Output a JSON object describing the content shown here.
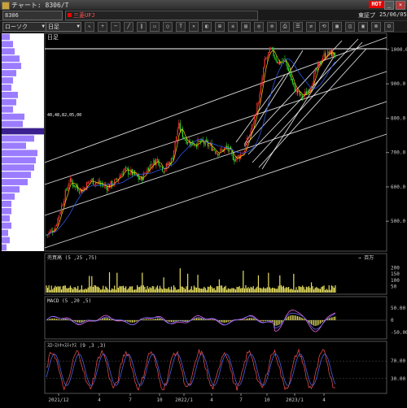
{
  "window": {
    "title": "チャート: 8306/T",
    "hot": "HOT"
  },
  "toolbar": {
    "code": "8306",
    "name": "三菱UFJ",
    "exchange": "東証プ",
    "date": "25/06/05",
    "chart_type": "ローソク",
    "period": "日足"
  },
  "panels": {
    "price_label": "日足",
    "volume_label": "売買高 (5 ,25 ,75)",
    "volume_unit": "→ 百万",
    "macd_label": "MACD (5 ,20 ,5)",
    "stoch_label": "ｽﾛｰｽﾄｷｬｽﾃｨｸｽ (9 ,3 ,3)",
    "profile_label": "40,48,82,05,00"
  },
  "chart_data": [
    {
      "type": "candlestick",
      "panel": "price",
      "yticks": [
        "1000.0",
        "900.0",
        "800.0",
        "700.0",
        "600.0",
        "500.0"
      ],
      "ylim": [
        420,
        1040
      ],
      "xticks": [
        "2021/12",
        "4",
        "7",
        "10",
        "2022/1",
        "4",
        "7",
        "10",
        "2023/1",
        "4"
      ],
      "close_path": [
        [
          0,
          460
        ],
        [
          8,
          480
        ],
        [
          16,
          560
        ],
        [
          22,
          620
        ],
        [
          28,
          600
        ],
        [
          34,
          590
        ],
        [
          42,
          620
        ],
        [
          50,
          610
        ],
        [
          58,
          600
        ],
        [
          66,
          615
        ],
        [
          74,
          650
        ],
        [
          82,
          640
        ],
        [
          90,
          620
        ],
        [
          98,
          660
        ],
        [
          106,
          680
        ],
        [
          112,
          650
        ],
        [
          120,
          680
        ],
        [
          126,
          780
        ],
        [
          132,
          740
        ],
        [
          140,
          725
        ],
        [
          148,
          730
        ],
        [
          156,
          720
        ],
        [
          164,
          700
        ],
        [
          172,
          715
        ],
        [
          180,
          680
        ],
        [
          188,
          700
        ],
        [
          196,
          770
        ],
        [
          204,
          870
        ],
        [
          208,
          960
        ],
        [
          214,
          1000
        ],
        [
          222,
          960
        ],
        [
          228,
          970
        ],
        [
          236,
          890
        ],
        [
          244,
          860
        ],
        [
          250,
          880
        ],
        [
          258,
          940
        ],
        [
          264,
          980
        ],
        [
          270,
          990
        ],
        [
          276,
          985
        ]
      ],
      "trend_lines_note": "parallel trend channels drawn in white"
    },
    {
      "type": "bar",
      "panel": "volume",
      "yticks": [
        "200",
        "150",
        "100",
        "50"
      ],
      "ylim": [
        0,
        250
      ]
    },
    {
      "type": "line",
      "panel": "macd",
      "yticks": [
        "50.00",
        "0",
        "-50.00"
      ],
      "ylim": [
        -70,
        70
      ]
    },
    {
      "type": "line",
      "panel": "stochastics",
      "yticks": [
        "70.00",
        "30.00"
      ],
      "ylim": [
        0,
        100
      ]
    }
  ],
  "colors": {
    "candle_up": "#ff3030",
    "candle_down": "#30e030",
    "ma1": "#ffd000",
    "ma2": "#3060ff",
    "volume": "#e8e060",
    "profile": "#9b7cff",
    "profile_hi": "#3a1f8f",
    "macd1": "#ff70ff",
    "macd2": "#7070ff",
    "stoch1": "#ff5050",
    "stoch2": "#5070ff",
    "trend": "#ffffff"
  }
}
